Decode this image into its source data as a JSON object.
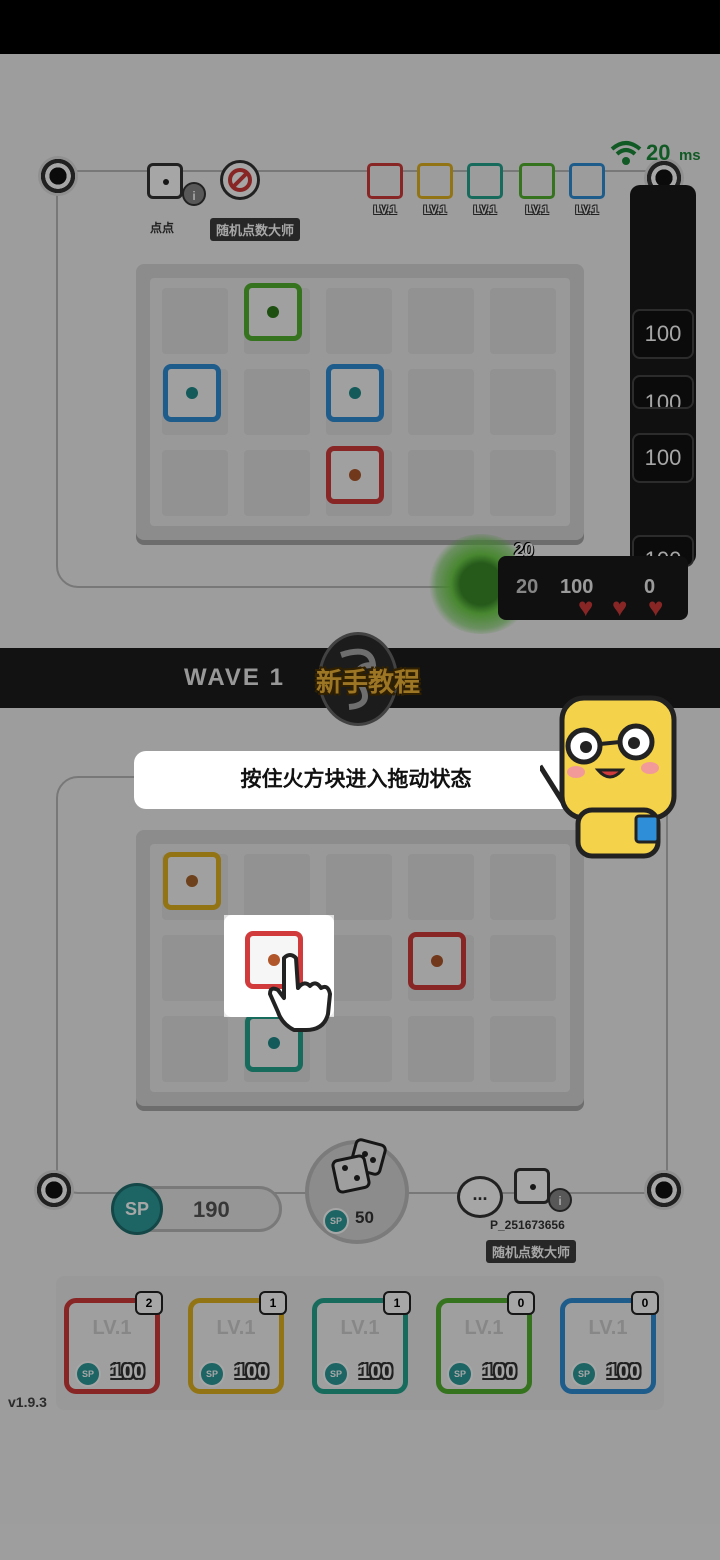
{
  "network": {
    "ping_value": "20",
    "ping_unit": "ms"
  },
  "opponent": {
    "name": "点点",
    "title": "随机点数大师",
    "dice_levels": [
      "LV.1",
      "LV.1",
      "LV.1",
      "LV.1",
      "LV.1"
    ],
    "card_stack": [
      "100",
      "100",
      "100",
      "100"
    ],
    "hp_badge": "20",
    "hp_value": "20",
    "lives": [
      "100",
      "0"
    ]
  },
  "wave": {
    "label": "WAVE 1",
    "tutorial_title": "新手教程"
  },
  "tutorial": {
    "tip": "按住火方块进入拖动状态"
  },
  "player": {
    "sp_label": "SP",
    "sp_value": "190",
    "summon_cost": "50",
    "summon_sp_label": "SP",
    "id": "P_251673656",
    "title": "随机点数大师",
    "chat_icon": "..."
  },
  "deck": [
    {
      "level": "LV.1",
      "cost": "100",
      "count": "2",
      "color": "#d23b3b"
    },
    {
      "level": "LV.1",
      "cost": "100",
      "count": "1",
      "color": "#e0b21f"
    },
    {
      "level": "LV.1",
      "cost": "100",
      "count": "1",
      "color": "#23a58f"
    },
    {
      "level": "LV.1",
      "cost": "100",
      "count": "0",
      "color": "#53b12e"
    },
    {
      "level": "LV.1",
      "cost": "100",
      "count": "0",
      "color": "#2e8ed8"
    }
  ],
  "version": "v1.9.3",
  "colors": {
    "red": "#d23b3b",
    "yellow": "#e0b21f",
    "teal": "#23a58f",
    "green": "#53b12e",
    "blue": "#2e8ed8"
  }
}
